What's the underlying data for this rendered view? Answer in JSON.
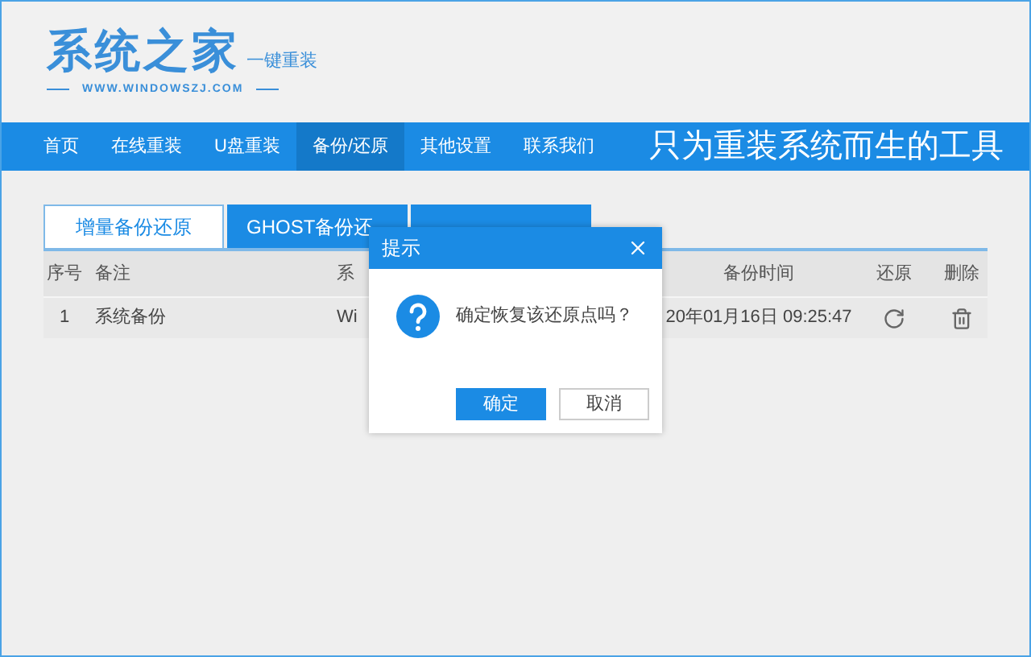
{
  "logo": {
    "title": "系统之家",
    "subtitle": "一键重装",
    "url": "WWW.WINDOWSZJ.COM"
  },
  "nav": {
    "items": [
      {
        "label": "首页",
        "selected": false
      },
      {
        "label": "在线重装",
        "selected": false
      },
      {
        "label": "U盘重装",
        "selected": false
      },
      {
        "label": "备份/还原",
        "selected": true
      },
      {
        "label": "其他设置",
        "selected": false
      },
      {
        "label": "联系我们",
        "selected": false
      }
    ],
    "slogan": "只为重装系统而生的工具"
  },
  "tabs": [
    {
      "label": "增量备份还原",
      "selected": true
    },
    {
      "label": "GHOST备份还",
      "selected": false
    },
    {
      "selected": false
    }
  ],
  "table": {
    "columns": [
      "序号",
      "备注",
      "系",
      "备份时间",
      "还原",
      "删除"
    ],
    "rows": [
      {
        "cells": [
          "1",
          "系统备份",
          "Wi",
          "20年01月16日 09:25:47"
        ]
      }
    ]
  },
  "dialog": {
    "title": "提示",
    "message": "确定恢复该还原点吗？",
    "buttons": [
      {
        "label": "确定",
        "kind": "primary"
      },
      {
        "label": "取消",
        "kind": "secondary"
      }
    ]
  }
}
